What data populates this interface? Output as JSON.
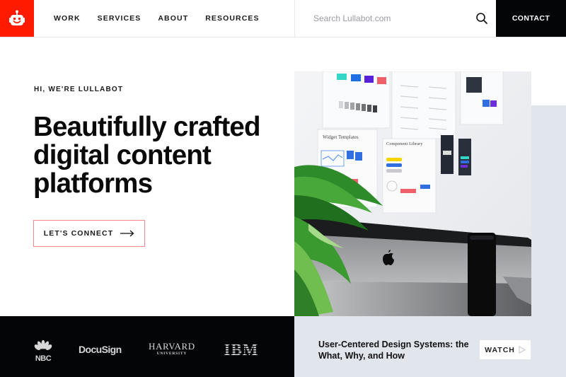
{
  "brand": {
    "logo_icon": "robot-icon",
    "accent_color": "#ff1a00"
  },
  "nav": {
    "items": [
      {
        "label": "WORK"
      },
      {
        "label": "SERVICES"
      },
      {
        "label": "ABOUT"
      },
      {
        "label": "RESOURCES"
      }
    ]
  },
  "search": {
    "placeholder": "Search Lullabot.com",
    "value": "",
    "icon": "search-icon"
  },
  "contact": {
    "label": "CONTACT"
  },
  "hero": {
    "eyebrow": "HI, WE'RE LULLABOT",
    "headline_lines": [
      "Beautifully crafted",
      "digital content",
      "platforms"
    ],
    "cta_label": "LET'S CONNECT",
    "cta_icon": "arrow-right-icon",
    "image": {
      "screen_labels": [
        "Widget Templates",
        "Component Library"
      ]
    }
  },
  "clients": {
    "logos": [
      {
        "name": "NBC",
        "text": "NBC"
      },
      {
        "name": "DocuSign",
        "text": "DocuSign"
      },
      {
        "name": "Harvard University",
        "text": "HARVARD",
        "subtext": "UNIVERSITY"
      },
      {
        "name": "IBM",
        "text": "IBM"
      }
    ]
  },
  "feature": {
    "title": "User-Centered Design Systems: the What, Why, and How",
    "watch_label": "WATCH",
    "watch_icon": "play-icon"
  }
}
